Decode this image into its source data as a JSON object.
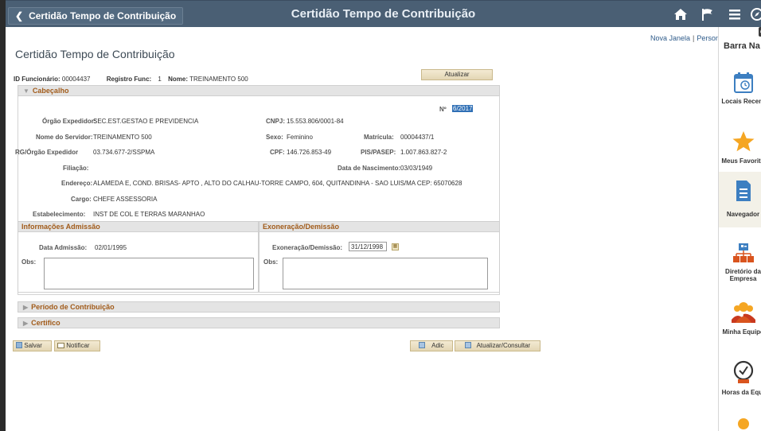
{
  "topbar": {
    "back_label": "Certidão Tempo de Contribuição",
    "title": "Certidão Tempo de Contribuição",
    "icons": [
      "home-icon",
      "flag-icon",
      "menu-icon",
      "compass-icon"
    ]
  },
  "links": {
    "nova_janela": "Nova Janela",
    "personalizar": "Persona"
  },
  "page": {
    "title": "Certidão Tempo de Contribuição",
    "id_funcionario_label": "ID Funcionário:",
    "id_funcionario_value": "00004437",
    "registro_label": "Registro Func:",
    "registro_value": "1",
    "nome_label": "Nome:",
    "nome_value": "TREINAMENTO 500",
    "atualizar": "Atualizar"
  },
  "cabecalho": {
    "header": "Cabeçalho",
    "numero_label": "Nº",
    "numero_value": "6/2017",
    "orgao_label": "Órgão Expedidor:",
    "orgao_value": "SEC.EST.GESTAO E PREVIDENCIA",
    "cnpj_label": "CNPJ:",
    "cnpj_value": "15.553.806/0001-84",
    "nome_servidor_label": "Nome do Servidor:",
    "nome_servidor_value": "TREINAMENTO 500",
    "sexo_label": "Sexo:",
    "sexo_value": "Feminino",
    "matricula_label": "Matrícula:",
    "matricula_value": "00004437/1",
    "rg_label": "RG/Órgão Expedidor",
    "rg_value": "03.734.677-2/SSPMA",
    "cpf_label": "CPF:",
    "cpf_value": "146.726.853-49",
    "pis_label": "PIS/PASEP:",
    "pis_value": "1.007.863.827-2",
    "filiacao_label": "Filiação:",
    "nascimento_label": "Data de Nascimento:",
    "nascimento_value": "03/03/1949",
    "endereco_label": "Endereço:",
    "endereco_value": "ALAMEDA E, COND. BRISAS- APTO , ALTO DO CALHAU-TORRE CAMPO, 604, QUITANDINHA - SAO LUIS/MA CEP: 65070628",
    "cargo_label": "Cargo:",
    "cargo_value": "CHEFE ASSESSORIA",
    "estab_label": "Estabelecimento:",
    "estab_value": "INST DE COL E TERRAS MARANHAO"
  },
  "admissao": {
    "header": "Informações Admissão",
    "data_label": "Data Admissão:",
    "data_value": "02/01/1995",
    "obs_label": "Obs:"
  },
  "exoneracao": {
    "header": "Exoneração/Demissão",
    "data_label": "Exoneração/Demissão:",
    "data_value": "31/12/1998",
    "obs_label": "Obs:"
  },
  "sections": {
    "periodo": "Período de Contribuição",
    "certifico": "Certifico"
  },
  "actions": {
    "salvar": "Salvar",
    "notificar": "Notificar",
    "adic": "Adic",
    "atualizar_consultar": "Atualizar/Consultar"
  },
  "rightpanel": {
    "title": "Barra Na",
    "items": [
      {
        "label": "Locais Recent",
        "icon": "recent-places-icon"
      },
      {
        "label": "Meus Favorito",
        "icon": "star-icon"
      },
      {
        "label": "Navegador",
        "icon": "document-icon"
      },
      {
        "label": "Diretório da",
        "label2": "Empresa",
        "icon": "org-chart-icon"
      },
      {
        "label": "Minha Equipe",
        "icon": "team-icon"
      },
      {
        "label": "Horas da Equi",
        "icon": "clock-icon"
      }
    ]
  },
  "colors": {
    "topbar": "#4a5f74",
    "section_title": "#a15b1a",
    "star": "#f5a623",
    "nav_blue": "#3d7fc1"
  }
}
